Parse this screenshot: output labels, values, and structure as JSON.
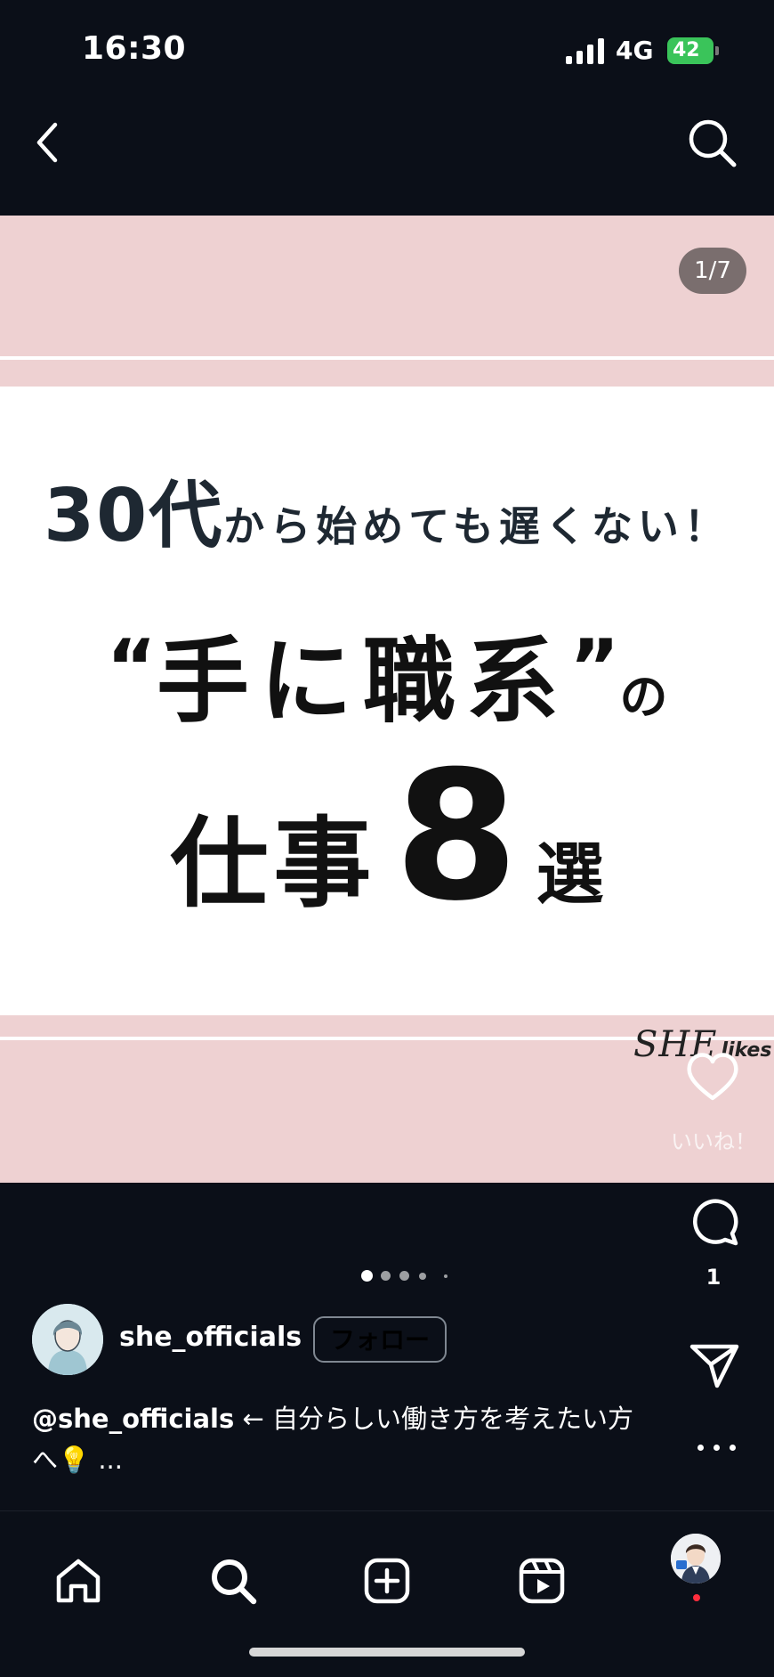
{
  "status_bar": {
    "time": "16:30",
    "network": "4G",
    "battery": "42"
  },
  "post": {
    "counter": "1/7",
    "headline": {
      "line1_big": "30代",
      "line1_small": "から始めても遅くない！",
      "line2_open_quote": "“",
      "line2_big": "手に職系",
      "line2_close_quote": "”",
      "line2_small": "の",
      "line3_big": "仕事",
      "line3_number": "8",
      "line3_small": "選"
    },
    "brand": {
      "she": "SHE",
      "likes": "likes"
    },
    "carousel_total_dots": 5,
    "carousel_active_index": 0
  },
  "actions": {
    "like_label": "いいね！",
    "comment_count": "1"
  },
  "profile": {
    "username": "she_officials",
    "follow_label": "フォロー"
  },
  "caption": {
    "handle": "@she_officials",
    "text": " ← 自分らしい働き方を考えたい方へ💡 ..."
  },
  "colors": {
    "background": "#0b0f18",
    "post_pink": "#eed1d2",
    "headline_dark": "#1e2832",
    "battery_green": "#3ac45a",
    "notification_red": "#ff2d3d"
  },
  "icons": {
    "top_left": "back-chevron-icon",
    "top_right": "search-icon",
    "rail": [
      "heart-icon",
      "comment-icon",
      "send-icon",
      "more-icon"
    ],
    "bottom_nav": [
      "home-icon",
      "search-icon",
      "create-icon",
      "reels-icon",
      "profile-avatar"
    ]
  }
}
